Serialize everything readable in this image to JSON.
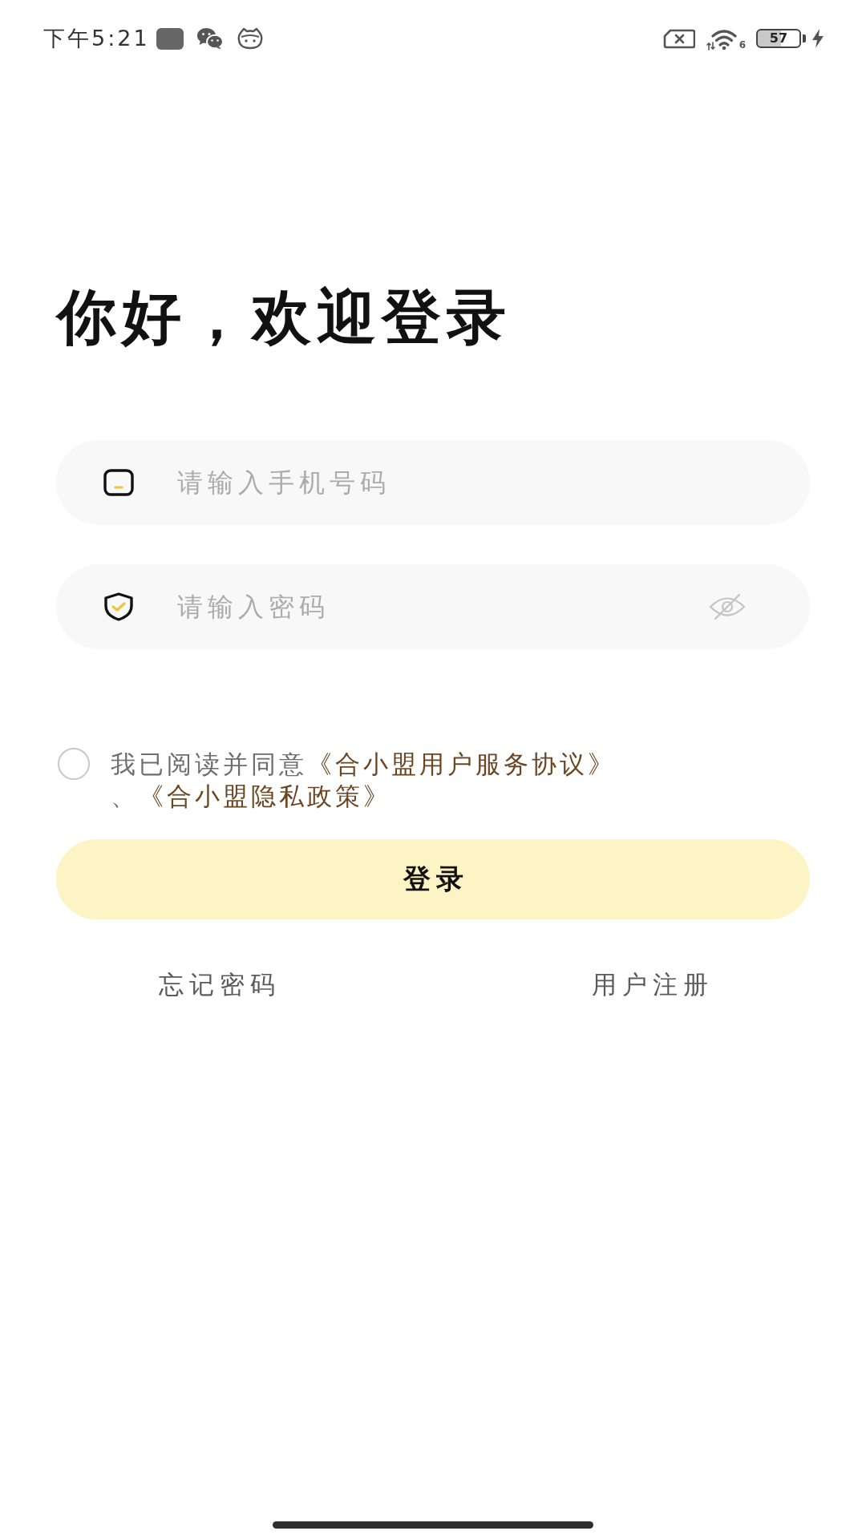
{
  "status_bar": {
    "time": "下午5:21",
    "wifi_generation": "6",
    "battery": "57",
    "charging": true
  },
  "heading": "你好，欢迎登录",
  "phone_field": {
    "placeholder": "请输入手机号码"
  },
  "password_field": {
    "placeholder": "请输入密码",
    "visible": false
  },
  "agreement": {
    "checked": false,
    "parts": [
      {
        "kind": "text",
        "text": "我已阅读并同意"
      },
      {
        "kind": "link",
        "text": "《合小盟用户服务协议》"
      },
      {
        "kind": "text",
        "text": "、"
      },
      {
        "kind": "link",
        "text": "《合小盟隐私政策》"
      }
    ]
  },
  "login_button": {
    "label": "登录"
  },
  "links": {
    "forgot_password": "忘记密码",
    "register": "用户注册"
  }
}
